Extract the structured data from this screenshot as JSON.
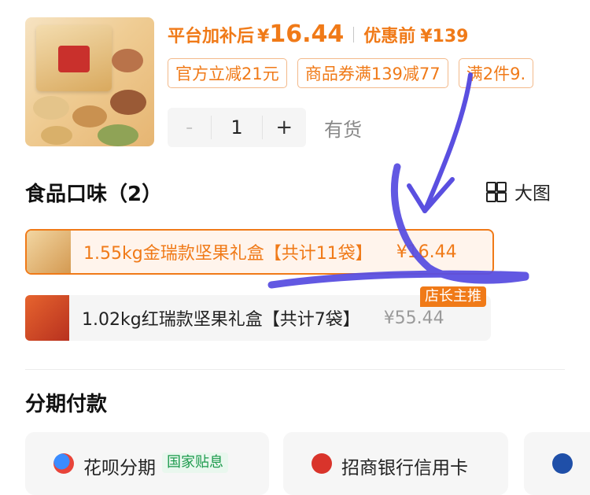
{
  "product": {
    "price_label": "平台加补后",
    "currency": "¥",
    "price_after_subsidy": "16.44",
    "original_label": "优惠前",
    "original_price": "¥139",
    "coupon_tags": [
      "官方立减21元",
      "商品券满139减77",
      "满2件9."
    ]
  },
  "quantity": {
    "minus": "-",
    "value": "1",
    "plus": "+",
    "stock_status": "有货"
  },
  "flavor_section": {
    "title": "食品口味（2）",
    "large_view_label": "大图",
    "variants": [
      {
        "name": "1.55kg金瑞款坚果礼盒【共计11袋】",
        "price": "¥16.44",
        "selected": true
      },
      {
        "name": "1.02kg红瑞款坚果礼盒【共计7袋】",
        "price": "¥55.44",
        "selected": false,
        "badge": "店长主推"
      }
    ]
  },
  "installment_section": {
    "title": "分期付款",
    "options": [
      {
        "label": "花呗分期",
        "tag": "国家贴息",
        "icon": "huabei-icon"
      },
      {
        "label": "招商银行信用卡",
        "icon": "cmb-bank-icon"
      },
      {
        "label": "",
        "icon": "bank-icon"
      }
    ]
  },
  "colors": {
    "accent": "#f07a18",
    "selected_bg": "#fff4ec",
    "gov_green": "#1c9a4c",
    "annotation_blue": "#5a4fe0"
  }
}
